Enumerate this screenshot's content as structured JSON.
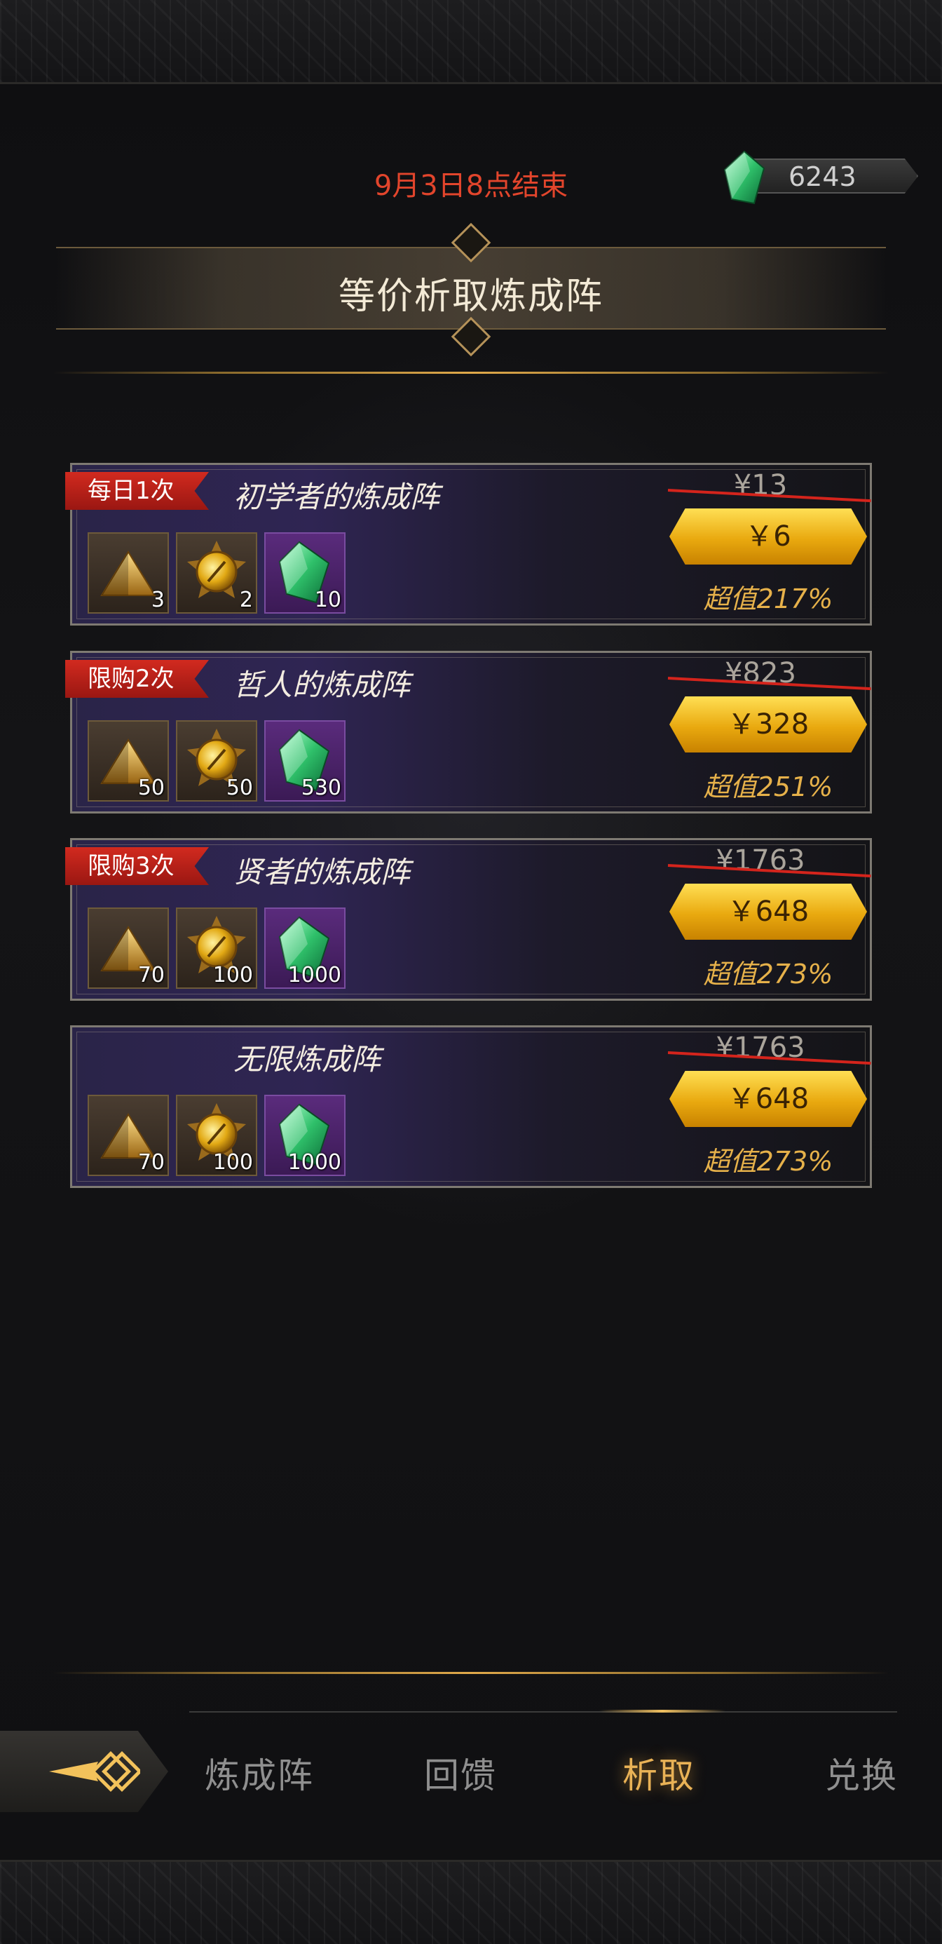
{
  "header": {
    "end_time": "9月3日8点结束",
    "currency": {
      "icon": "green-gem-icon",
      "amount": "6243"
    },
    "title": "等价析取炼成阵"
  },
  "offers": [
    {
      "badge": "每日1次",
      "name": "初学者的炼成阵",
      "items": [
        {
          "icon": "gold-pyramid-icon",
          "qty": "3"
        },
        {
          "icon": "golden-orb-icon",
          "qty": "2"
        },
        {
          "icon": "green-gem-icon",
          "qty": "10"
        }
      ],
      "original_price": "¥13",
      "price": "￥6",
      "value": "超值217%"
    },
    {
      "badge": "限购2次",
      "name": "哲人的炼成阵",
      "items": [
        {
          "icon": "gold-pyramid-icon",
          "qty": "50"
        },
        {
          "icon": "golden-orb-icon",
          "qty": "50"
        },
        {
          "icon": "green-gem-icon",
          "qty": "530"
        }
      ],
      "original_price": "¥823",
      "price": "￥328",
      "value": "超值251%"
    },
    {
      "badge": "限购3次",
      "name": "贤者的炼成阵",
      "items": [
        {
          "icon": "gold-pyramid-icon",
          "qty": "70"
        },
        {
          "icon": "golden-orb-icon",
          "qty": "100"
        },
        {
          "icon": "green-gem-icon",
          "qty": "1000"
        }
      ],
      "original_price": "¥1763",
      "price": "￥648",
      "value": "超值273%"
    },
    {
      "badge": "",
      "name": "无限炼成阵",
      "items": [
        {
          "icon": "gold-pyramid-icon",
          "qty": "70"
        },
        {
          "icon": "golden-orb-icon",
          "qty": "100"
        },
        {
          "icon": "green-gem-icon",
          "qty": "1000"
        }
      ],
      "original_price": "¥1763",
      "price": "￥648",
      "value": "超值273%"
    }
  ],
  "nav": {
    "back_icon": "back-arrow-icon",
    "tabs": [
      {
        "label": "炼成阵",
        "active": false
      },
      {
        "label": "回馈",
        "active": false
      },
      {
        "label": "析取",
        "active": true
      },
      {
        "label": "兑换",
        "active": false
      }
    ]
  },
  "colors": {
    "accent_gold": "#e9b256",
    "end_time_red": "#e2452c",
    "badge_red": "#d22a1f",
    "value_orange": "#e6b14a"
  }
}
